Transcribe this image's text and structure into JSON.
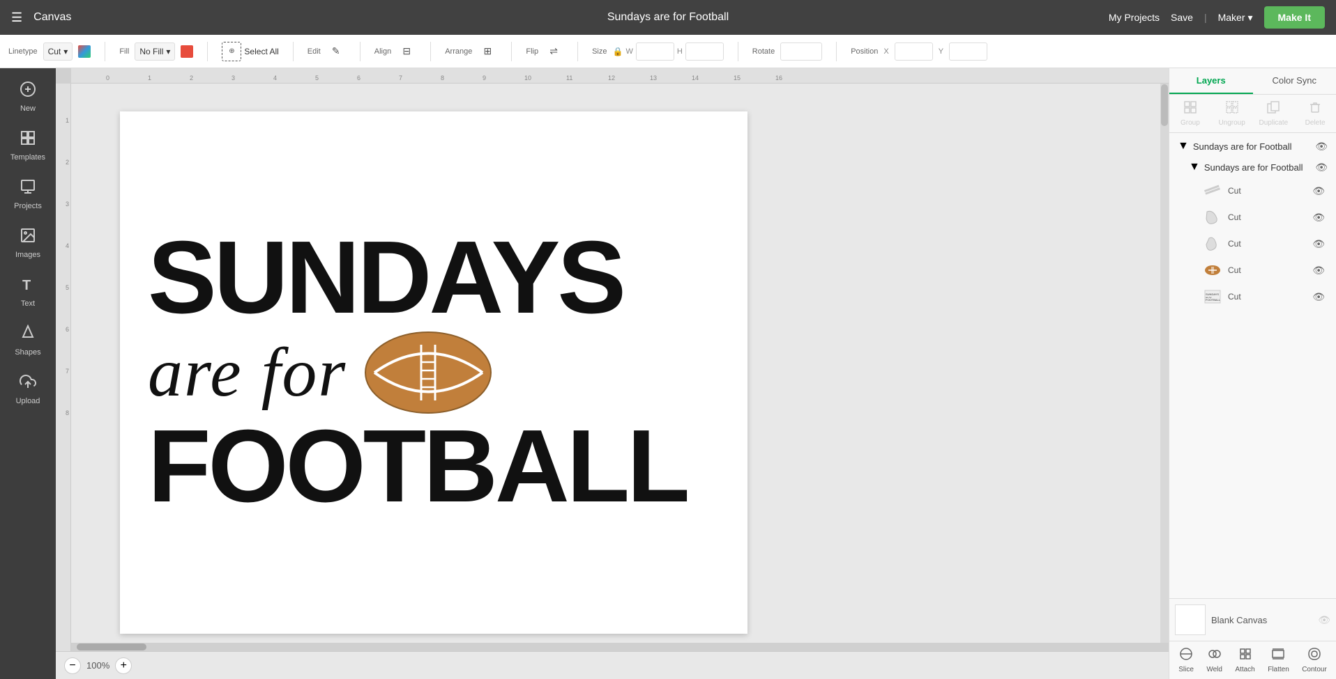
{
  "header": {
    "menu_icon": "☰",
    "logo": "Canvas",
    "title": "Sundays are for Football",
    "my_projects_label": "My Projects",
    "save_label": "Save",
    "divider": "|",
    "maker_label": "Maker",
    "make_it_label": "Make It"
  },
  "toolbar": {
    "linetype_label": "Linetype",
    "linetype_value": "Cut",
    "fill_label": "Fill",
    "fill_value": "No Fill",
    "select_all_label": "Select All",
    "edit_label": "Edit",
    "align_label": "Align",
    "arrange_label": "Arrange",
    "flip_label": "Flip",
    "size_label": "Size",
    "w_label": "W",
    "h_label": "H",
    "rotate_label": "Rotate",
    "position_label": "Position",
    "x_label": "X",
    "y_label": "Y"
  },
  "sidebar": {
    "items": [
      {
        "id": "new",
        "icon": "+",
        "label": "New"
      },
      {
        "id": "templates",
        "icon": "▦",
        "label": "Templates"
      },
      {
        "id": "projects",
        "icon": "◫",
        "label": "Projects"
      },
      {
        "id": "images",
        "icon": "🖼",
        "label": "Images"
      },
      {
        "id": "text",
        "icon": "T",
        "label": "Text"
      },
      {
        "id": "shapes",
        "icon": "⬡",
        "label": "Shapes"
      },
      {
        "id": "upload",
        "icon": "⬆",
        "label": "Upload"
      }
    ]
  },
  "canvas": {
    "design_title": "SUNDAYS",
    "design_subtitle": "are for",
    "design_word": "FOOTBALL",
    "zoom_value": "100%"
  },
  "right_panel": {
    "tabs": [
      "Layers",
      "Color Sync"
    ],
    "actions": [
      "Group",
      "Ungroup",
      "Duplicate",
      "Delete"
    ],
    "group_label": "Sundays are for Football",
    "sub_group_label": "Sundays are for Football",
    "layers": [
      {
        "id": "layer1",
        "label": "Cut",
        "thumb": "✎"
      },
      {
        "id": "layer2",
        "label": "Cut",
        "thumb": "⚑"
      },
      {
        "id": "layer3",
        "label": "Cut",
        "thumb": "⚑"
      },
      {
        "id": "layer4",
        "label": "Cut",
        "thumb": "🏈"
      },
      {
        "id": "layer5",
        "label": "Cut",
        "thumb": "▤"
      }
    ],
    "blank_canvas_label": "Blank Canvas",
    "bottom_actions": [
      "Slice",
      "Weld",
      "Attach",
      "Flatten",
      "Contour"
    ]
  }
}
